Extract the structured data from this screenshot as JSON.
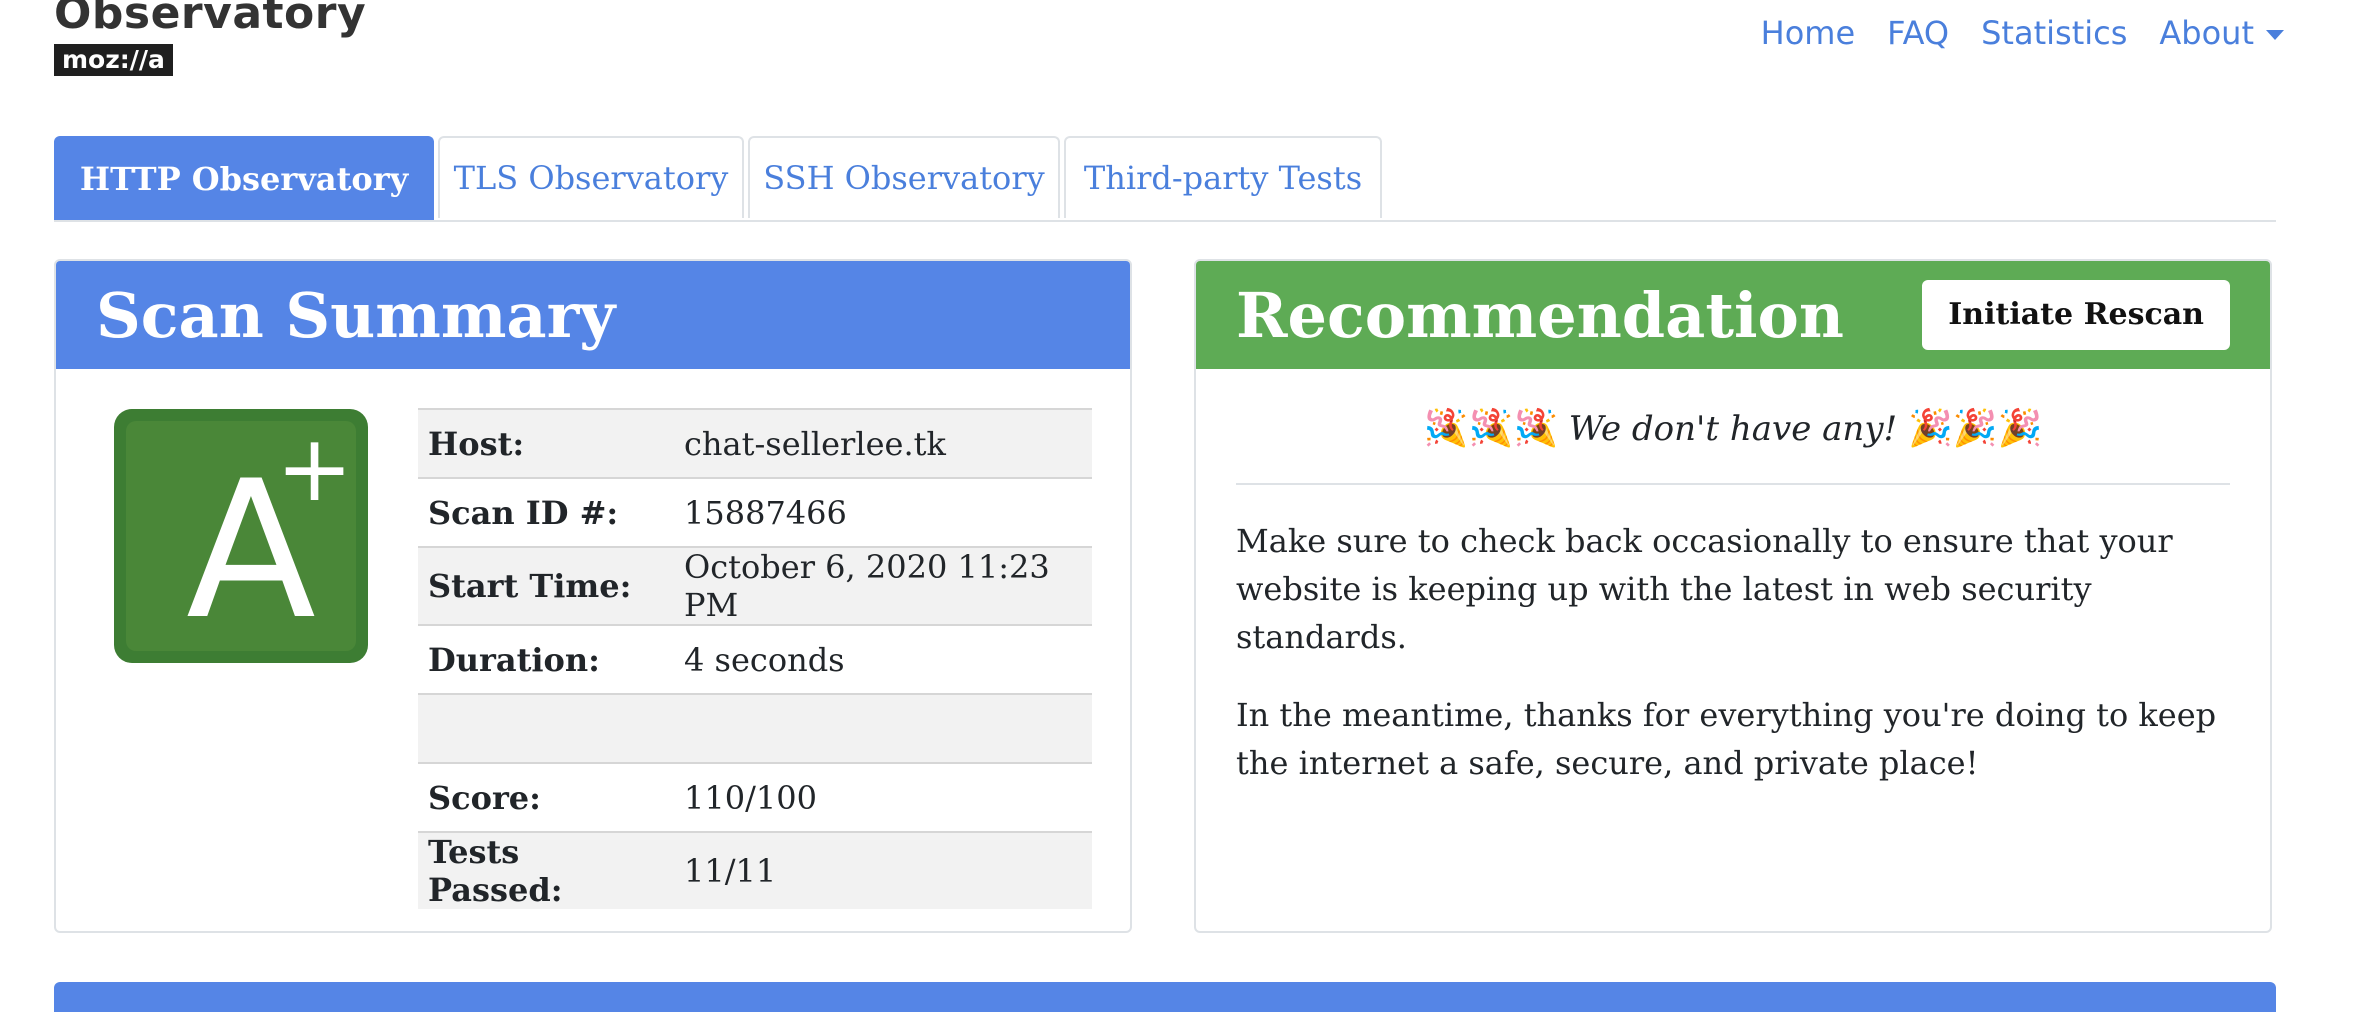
{
  "brand": {
    "title": "Observatory",
    "badge": "moz://a"
  },
  "nav": {
    "items": [
      "Home",
      "FAQ",
      "Statistics",
      "About"
    ]
  },
  "tabs": [
    "HTTP Observatory",
    "TLS Observatory",
    "SSH Observatory",
    "Third-party Tests"
  ],
  "summary": {
    "heading": "Scan Summary",
    "grade_letter": "A",
    "grade_modifier": "+",
    "rows": [
      {
        "key": "Host:",
        "value": "chat-sellerlee.tk"
      },
      {
        "key": "Scan ID #:",
        "value": "15887466"
      },
      {
        "key": "Start Time:",
        "value": "October 6, 2020 11:23 PM"
      },
      {
        "key": "Duration:",
        "value": "4 seconds"
      },
      {
        "key": "",
        "value": ""
      },
      {
        "key": "Score:",
        "value": "110/100"
      },
      {
        "key": "Tests Passed:",
        "value": "11/11"
      }
    ]
  },
  "recommendation": {
    "heading": "Recommendation",
    "rescan_label": "Initiate Rescan",
    "emoji": "🎉🎉🎉",
    "none_text": "We don't have any!",
    "para1": "Make sure to check back occasionally to ensure that your website is keeping up with the latest in web security standards.",
    "para2": "In the meantime, thanks for everything you're doing to keep the internet a safe, secure, and private place!"
  },
  "colors": {
    "primary": "#5585e6",
    "success": "#5eab55",
    "grade": "#3d7d33",
    "link": "#4a7fdc"
  }
}
